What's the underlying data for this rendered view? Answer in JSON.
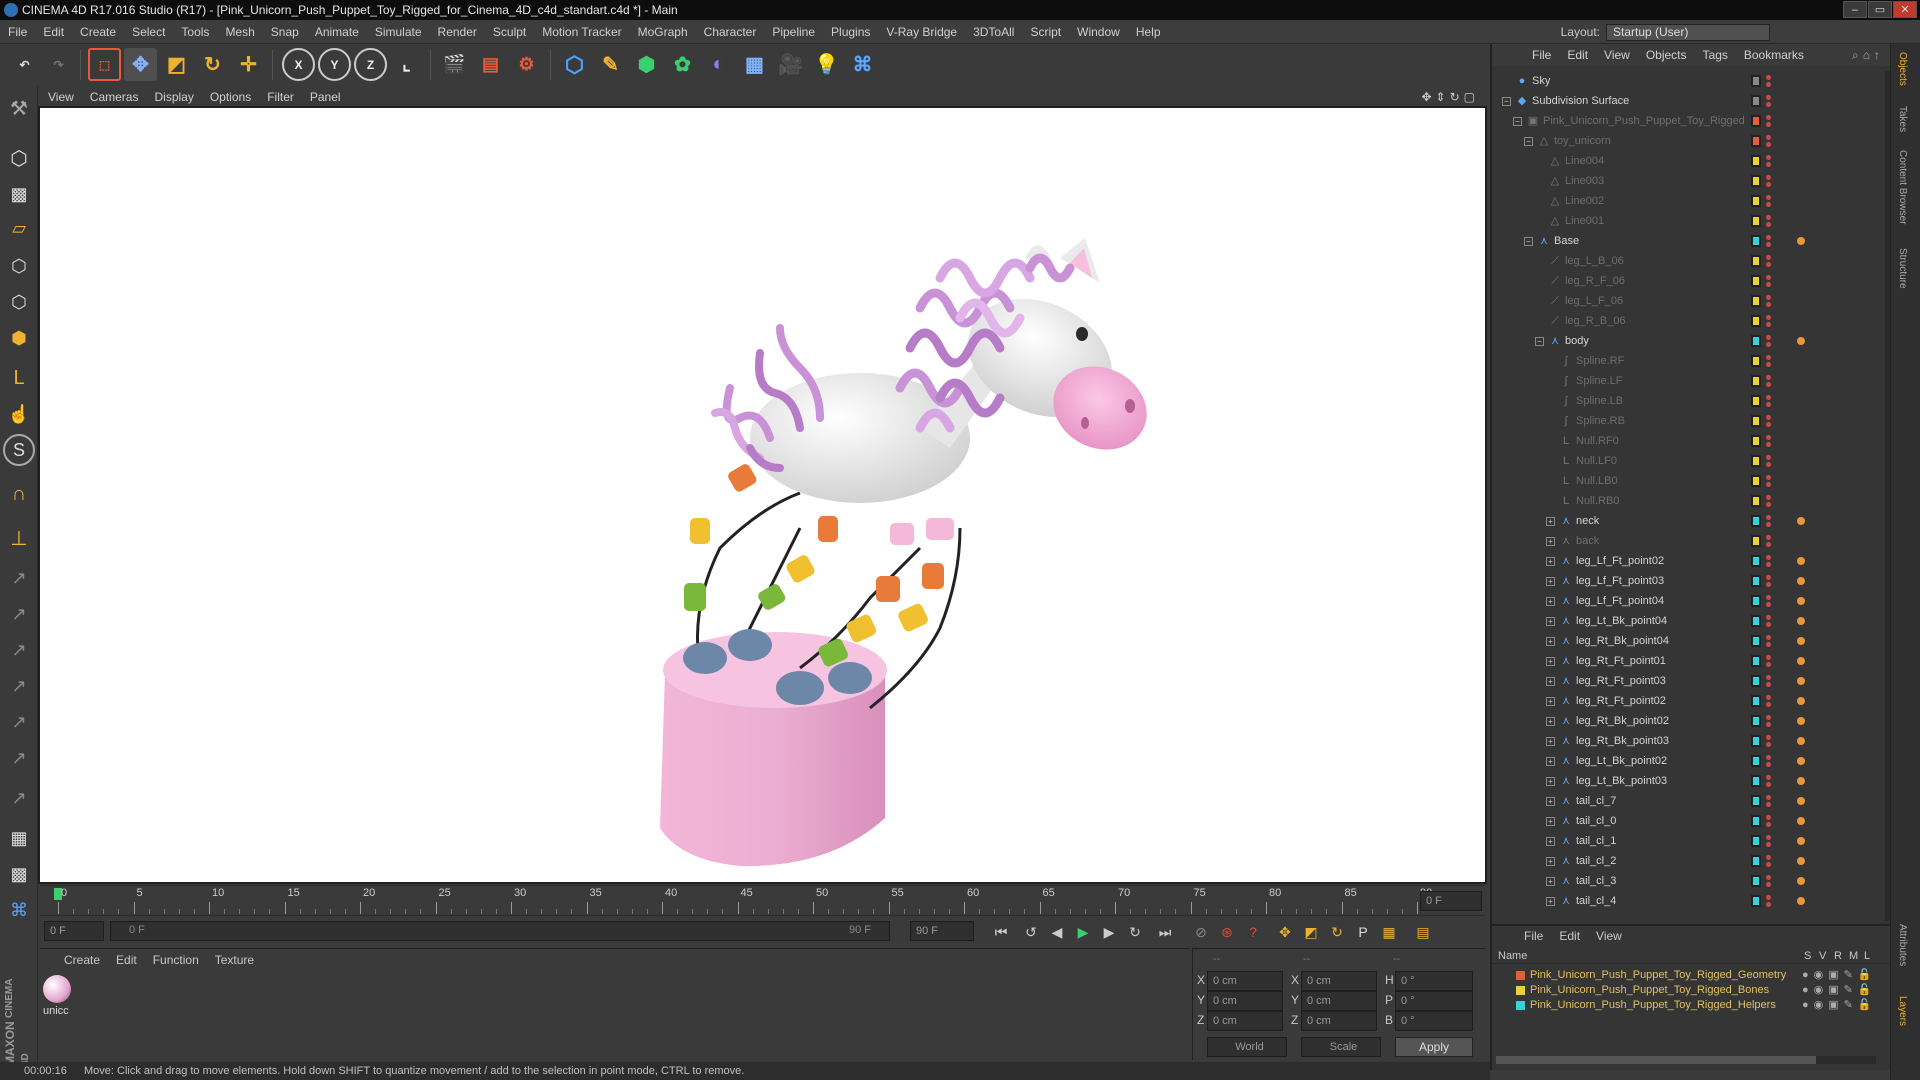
{
  "window": {
    "title": "CINEMA 4D R17.016 Studio (R17) - [Pink_Unicorn_Push_Puppet_Toy_Rigged_for_Cinema_4D_c4d_standart.c4d *] - Main"
  },
  "menubar": {
    "items": [
      "File",
      "Edit",
      "Create",
      "Select",
      "Tools",
      "Mesh",
      "Snap",
      "Animate",
      "Simulate",
      "Render",
      "Sculpt",
      "Motion Tracker",
      "MoGraph",
      "Character",
      "Pipeline",
      "Plugins",
      "V-Ray Bridge",
      "3DToAll",
      "Script",
      "Window",
      "Help"
    ],
    "layout_label": "Layout:",
    "layout_value": "Startup (User)"
  },
  "viewport": {
    "menu": [
      "View",
      "Cameras",
      "Display",
      "Options",
      "Filter",
      "Panel"
    ]
  },
  "timeline": {
    "ticks": [
      "0",
      "5",
      "10",
      "15",
      "20",
      "25",
      "30",
      "35",
      "40",
      "45",
      "50",
      "55",
      "60",
      "65",
      "70",
      "75",
      "80",
      "85",
      "90"
    ],
    "end_frame_field": "0 F",
    "current_frame_field": "0 F",
    "slider_start": "0 F",
    "slider_end": "90 F",
    "max_frame_field": "90 F"
  },
  "material_panel": {
    "menu": [
      "Create",
      "Edit",
      "Function",
      "Texture"
    ],
    "material_name": "unicc"
  },
  "coord_panel": {
    "rows": [
      {
        "pos_label": "X",
        "pos": "0 cm",
        "size_label": "X",
        "size": "0 cm",
        "rot_label": "H",
        "rot": "0 °"
      },
      {
        "pos_label": "Y",
        "pos": "0 cm",
        "size_label": "Y",
        "size": "0 cm",
        "rot_label": "P",
        "rot": "0 °"
      },
      {
        "pos_label": "Z",
        "pos": "0 cm",
        "size_label": "Z",
        "size": "0 cm",
        "rot_label": "B",
        "rot": "0 °"
      }
    ],
    "top_dashes": [
      "--",
      "--",
      "--"
    ],
    "world": "World",
    "scale": "Scale",
    "apply": "Apply"
  },
  "status": {
    "time": "00:00:16",
    "message": "Move: Click and drag to move elements. Hold down SHIFT to quantize movement / add to the selection in point mode, CTRL to remove."
  },
  "object_manager": {
    "menu": [
      "File",
      "Edit",
      "View",
      "Objects",
      "Tags",
      "Bookmarks"
    ],
    "rows": [
      {
        "name": "Sky",
        "indent": 0,
        "expand": "",
        "icon": "●",
        "tag": "#888",
        "greyed": false
      },
      {
        "name": "Subdivision Surface",
        "indent": 0,
        "expand": "-",
        "icon": "◆",
        "tag": "#888",
        "greyed": false
      },
      {
        "name": "Pink_Unicorn_Push_Puppet_Toy_Rigged",
        "indent": 1,
        "expand": "-",
        "icon": "▣",
        "tag": "#e0603a",
        "greyed": true
      },
      {
        "name": "toy_unicorn",
        "indent": 2,
        "expand": "-",
        "icon": "△",
        "tag": "#e0603a",
        "greyed": true
      },
      {
        "name": "Line004",
        "indent": 3,
        "expand": "",
        "icon": "△",
        "tag": "#e8d23a",
        "greyed": true
      },
      {
        "name": "Line003",
        "indent": 3,
        "expand": "",
        "icon": "△",
        "tag": "#e8d23a",
        "greyed": true
      },
      {
        "name": "Line002",
        "indent": 3,
        "expand": "",
        "icon": "△",
        "tag": "#e8d23a",
        "greyed": true
      },
      {
        "name": "Line001",
        "indent": 3,
        "expand": "",
        "icon": "△",
        "tag": "#e8d23a",
        "greyed": true
      },
      {
        "name": "Base",
        "indent": 2,
        "expand": "-",
        "icon": "⋏",
        "tag": "#3ad0d8",
        "greyed": false
      },
      {
        "name": "leg_L_B_06",
        "indent": 3,
        "expand": "",
        "icon": "⟋",
        "tag": "#e8d23a",
        "greyed": true
      },
      {
        "name": "leg_R_F_06",
        "indent": 3,
        "expand": "",
        "icon": "⟋",
        "tag": "#e8d23a",
        "greyed": true
      },
      {
        "name": "leg_L_F_06",
        "indent": 3,
        "expand": "",
        "icon": "⟋",
        "tag": "#e8d23a",
        "greyed": true
      },
      {
        "name": "leg_R_B_06",
        "indent": 3,
        "expand": "",
        "icon": "⟋",
        "tag": "#e8d23a",
        "greyed": true
      },
      {
        "name": "body",
        "indent": 3,
        "expand": "-",
        "icon": "⋏",
        "tag": "#3ad0d8",
        "greyed": false
      },
      {
        "name": "Spline.RF",
        "indent": 4,
        "expand": "",
        "icon": "∫",
        "tag": "#e8d23a",
        "greyed": true
      },
      {
        "name": "Spline.LF",
        "indent": 4,
        "expand": "",
        "icon": "∫",
        "tag": "#e8d23a",
        "greyed": true
      },
      {
        "name": "Spline.LB",
        "indent": 4,
        "expand": "",
        "icon": "∫",
        "tag": "#e8d23a",
        "greyed": true
      },
      {
        "name": "Spline.RB",
        "indent": 4,
        "expand": "",
        "icon": "∫",
        "tag": "#e8d23a",
        "greyed": true
      },
      {
        "name": "Null.RF0",
        "indent": 4,
        "expand": "",
        "icon": "L",
        "tag": "#e8d23a",
        "greyed": true
      },
      {
        "name": "Null.LF0",
        "indent": 4,
        "expand": "",
        "icon": "L",
        "tag": "#e8d23a",
        "greyed": true
      },
      {
        "name": "Null.LB0",
        "indent": 4,
        "expand": "",
        "icon": "L",
        "tag": "#e8d23a",
        "greyed": true
      },
      {
        "name": "Null.RB0",
        "indent": 4,
        "expand": "",
        "icon": "L",
        "tag": "#e8d23a",
        "greyed": true
      },
      {
        "name": "neck",
        "indent": 4,
        "expand": "+",
        "icon": "⋏",
        "tag": "#3ad0d8",
        "greyed": false
      },
      {
        "name": "back",
        "indent": 4,
        "expand": "+",
        "icon": "⋏",
        "tag": "#e8d23a",
        "greyed": true
      },
      {
        "name": "leg_Lf_Ft_point02",
        "indent": 4,
        "expand": "+",
        "icon": "⋏",
        "tag": "#3ad0d8",
        "greyed": false
      },
      {
        "name": "leg_Lf_Ft_point03",
        "indent": 4,
        "expand": "+",
        "icon": "⋏",
        "tag": "#3ad0d8",
        "greyed": false
      },
      {
        "name": "leg_Lf_Ft_point04",
        "indent": 4,
        "expand": "+",
        "icon": "⋏",
        "tag": "#3ad0d8",
        "greyed": false
      },
      {
        "name": "leg_Lt_Bk_point04",
        "indent": 4,
        "expand": "+",
        "icon": "⋏",
        "tag": "#3ad0d8",
        "greyed": false
      },
      {
        "name": "leg_Rt_Bk_point04",
        "indent": 4,
        "expand": "+",
        "icon": "⋏",
        "tag": "#3ad0d8",
        "greyed": false
      },
      {
        "name": "leg_Rt_Ft_point01",
        "indent": 4,
        "expand": "+",
        "icon": "⋏",
        "tag": "#3ad0d8",
        "greyed": false
      },
      {
        "name": "leg_Rt_Ft_point03",
        "indent": 4,
        "expand": "+",
        "icon": "⋏",
        "tag": "#3ad0d8",
        "greyed": false
      },
      {
        "name": "leg_Rt_Ft_point02",
        "indent": 4,
        "expand": "+",
        "icon": "⋏",
        "tag": "#3ad0d8",
        "greyed": false
      },
      {
        "name": "leg_Rt_Bk_point02",
        "indent": 4,
        "expand": "+",
        "icon": "⋏",
        "tag": "#3ad0d8",
        "greyed": false
      },
      {
        "name": "leg_Rt_Bk_point03",
        "indent": 4,
        "expand": "+",
        "icon": "⋏",
        "tag": "#3ad0d8",
        "greyed": false
      },
      {
        "name": "leg_Lt_Bk_point02",
        "indent": 4,
        "expand": "+",
        "icon": "⋏",
        "tag": "#3ad0d8",
        "greyed": false
      },
      {
        "name": "leg_Lt_Bk_point03",
        "indent": 4,
        "expand": "+",
        "icon": "⋏",
        "tag": "#3ad0d8",
        "greyed": false
      },
      {
        "name": "tail_cl_7",
        "indent": 4,
        "expand": "+",
        "icon": "⋏",
        "tag": "#3ad0d8",
        "greyed": false
      },
      {
        "name": "tail_cl_0",
        "indent": 4,
        "expand": "+",
        "icon": "⋏",
        "tag": "#3ad0d8",
        "greyed": false
      },
      {
        "name": "tail_cl_1",
        "indent": 4,
        "expand": "+",
        "icon": "⋏",
        "tag": "#3ad0d8",
        "greyed": false
      },
      {
        "name": "tail_cl_2",
        "indent": 4,
        "expand": "+",
        "icon": "⋏",
        "tag": "#3ad0d8",
        "greyed": false
      },
      {
        "name": "tail_cl_3",
        "indent": 4,
        "expand": "+",
        "icon": "⋏",
        "tag": "#3ad0d8",
        "greyed": false
      },
      {
        "name": "tail_cl_4",
        "indent": 4,
        "expand": "+",
        "icon": "⋏",
        "tag": "#3ad0d8",
        "greyed": false
      }
    ]
  },
  "side_tabs": [
    "Objects",
    "Takes",
    "Content Browser",
    "Structure",
    "Attributes",
    "Layers"
  ],
  "layer_manager": {
    "menu": [
      "File",
      "Edit",
      "View"
    ],
    "header_name": "Name",
    "header_cols": [
      "S",
      "V",
      "R",
      "M",
      "L"
    ],
    "layers": [
      {
        "name": "Pink_Unicorn_Push_Puppet_Toy_Rigged_Geometry",
        "color": "#e0603a"
      },
      {
        "name": "Pink_Unicorn_Push_Puppet_Toy_Rigged_Bones",
        "color": "#e8d23a"
      },
      {
        "name": "Pink_Unicorn_Push_Puppet_Toy_Rigged_Helpers",
        "color": "#3ad0d8"
      }
    ]
  },
  "brand": {
    "maxon": "MAXON",
    "cinema": "CINEMA 4D"
  }
}
